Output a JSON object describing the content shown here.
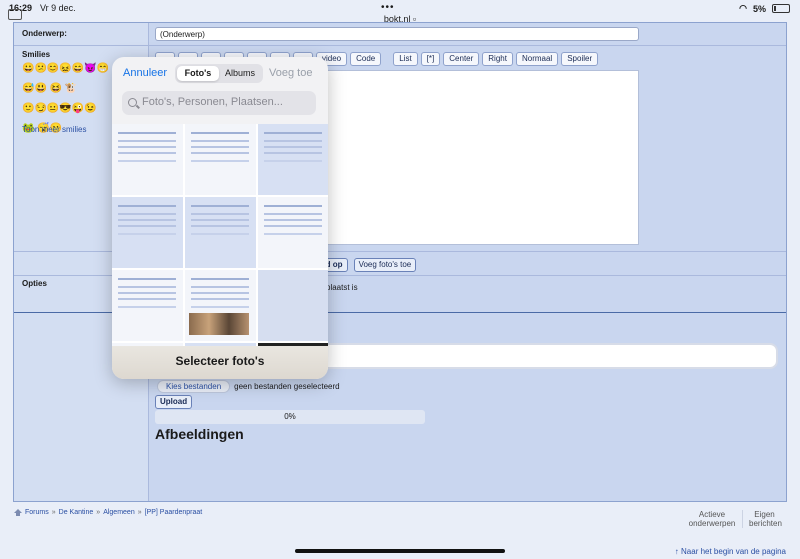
{
  "status": {
    "time": "16:29",
    "date": "Vr 9 dec.",
    "url": "bokt.nl",
    "battery": "5%"
  },
  "form": {
    "subject_label": "Onderwerp:",
    "subject_value": "(Onderwerp)",
    "smilies_label": "Smilies",
    "more_smilies": "Toon meer smilies",
    "options_label": "Opties",
    "toolbar": [
      "video",
      "Code",
      "List",
      "[*]",
      "Center",
      "Right",
      "Normaal",
      "Spoiler"
    ],
    "button_save_partial": "lad op",
    "button_add_photos": "Voeg foto's toe",
    "options_text_partial": "plaatst is",
    "choose_files": "Kies bestanden",
    "no_files": "geen bestanden geselecteerd",
    "upload": "Upload",
    "progress": "0%",
    "images_heading": "Afbeeldingen"
  },
  "picker": {
    "cancel": "Annuleer",
    "tabs": [
      "Foto's",
      "Albums"
    ],
    "active_tab": "Foto's",
    "add": "Voeg toe",
    "search_placeholder": "Foto's, Personen, Plaatsen...",
    "footer": "Selecteer foto's"
  },
  "footer": {
    "breadcrumb": [
      "Forums",
      "De Kantine",
      "Algemeen",
      "[PP] Paardenpraat"
    ],
    "active_topics": "Actieve onderwerpen",
    "own_posts": "Eigen berichten",
    "to_top": "↑ Naar het begin van de pagina"
  }
}
